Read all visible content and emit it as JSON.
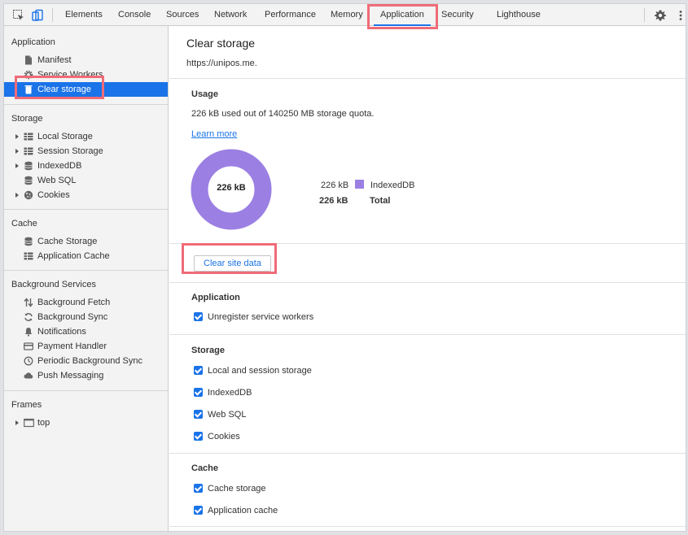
{
  "toolbar": {
    "tabs": [
      "Elements",
      "Console",
      "Sources",
      "Network",
      "Performance",
      "Memory",
      "Application",
      "Security",
      "Lighthouse"
    ],
    "active_tab": "Application"
  },
  "sidebar": {
    "application": {
      "heading": "Application",
      "items": [
        "Manifest",
        "Service Workers",
        "Clear storage"
      ]
    },
    "storage": {
      "heading": "Storage",
      "items": [
        "Local Storage",
        "Session Storage",
        "IndexedDB",
        "Web SQL",
        "Cookies"
      ]
    },
    "cache": {
      "heading": "Cache",
      "items": [
        "Cache Storage",
        "Application Cache"
      ]
    },
    "background": {
      "heading": "Background Services",
      "items": [
        "Background Fetch",
        "Background Sync",
        "Notifications",
        "Payment Handler",
        "Periodic Background Sync",
        "Push Messaging"
      ]
    },
    "frames": {
      "heading": "Frames",
      "items": [
        "top"
      ]
    }
  },
  "main": {
    "title": "Clear storage",
    "origin": "https://unipos.me.",
    "usage": {
      "heading": "Usage",
      "summary": "226 kB used out of 140250 MB storage quota.",
      "learn_more": "Learn more",
      "donut_label": "226 kB",
      "donut_fraction": 1.0,
      "legend": [
        {
          "value": "226 kB",
          "label": "IndexedDB",
          "color": "#9b7fe3"
        },
        {
          "value": "226 kB",
          "label": "Total"
        }
      ]
    },
    "clear_button": "Clear site data",
    "application": {
      "heading": "Application",
      "options": [
        "Unregister service workers"
      ]
    },
    "storage": {
      "heading": "Storage",
      "options": [
        "Local and session storage",
        "IndexedDB",
        "Web SQL",
        "Cookies"
      ]
    },
    "cache": {
      "heading": "Cache",
      "options": [
        "Cache storage",
        "Application cache"
      ]
    }
  },
  "colors": {
    "accent": "#1a73e8",
    "highlight": "#ef6b78",
    "donut": "#9b7fe3"
  }
}
